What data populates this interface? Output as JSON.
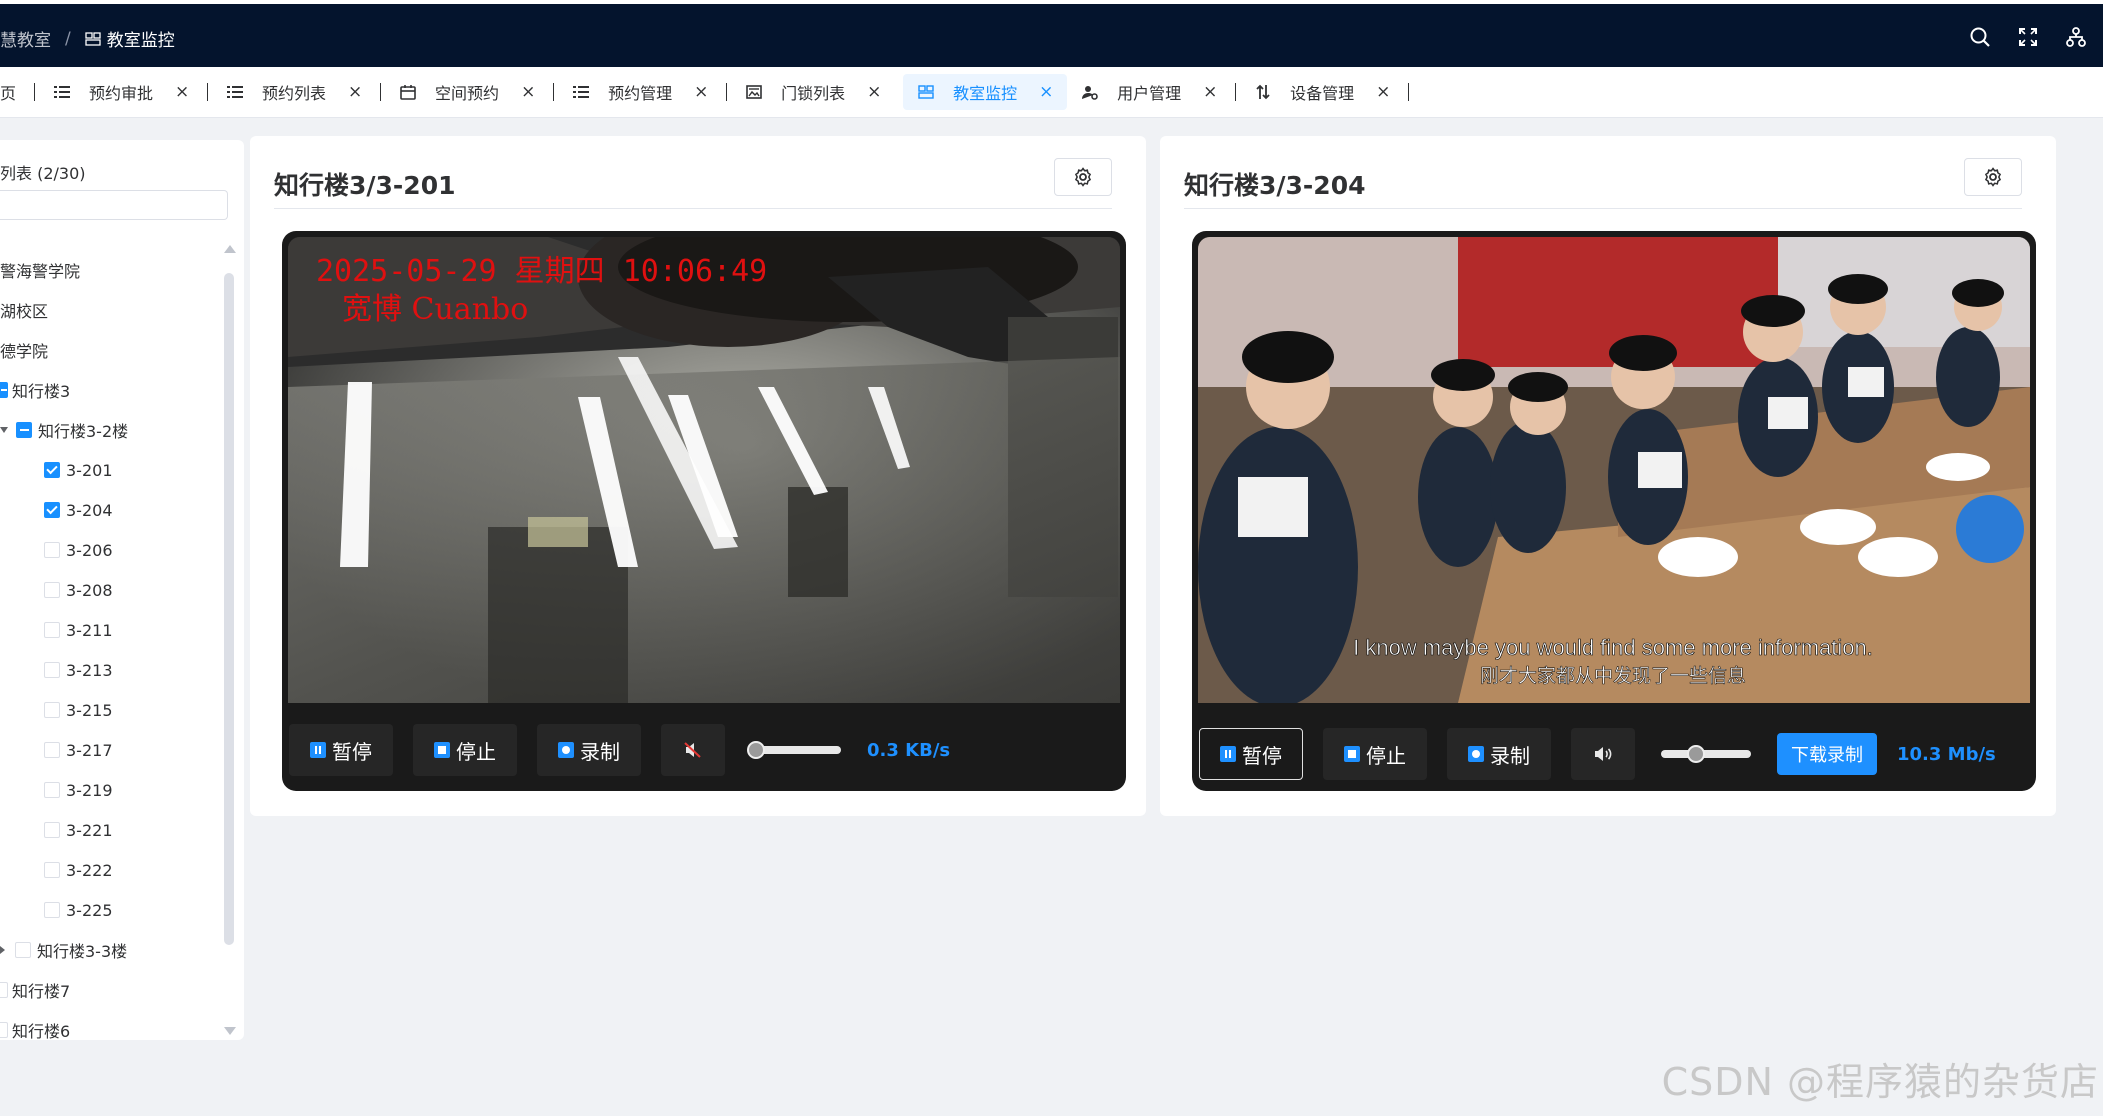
{
  "breadcrumb": {
    "parent": "慧教室",
    "separator": "/",
    "current": "教室监控"
  },
  "header_icons": [
    "search-icon",
    "fullscreen-icon",
    "sitemap-icon"
  ],
  "tabs": [
    {
      "label": "页",
      "icon": ""
    },
    {
      "label": "预约审批",
      "icon": "list-icon",
      "close": "×"
    },
    {
      "label": "预约列表",
      "icon": "list-icon",
      "close": "×"
    },
    {
      "label": "空间预约",
      "icon": "calendar-icon",
      "close": "×"
    },
    {
      "label": "预约管理",
      "icon": "list-icon",
      "close": "×"
    },
    {
      "label": "门锁列表",
      "icon": "image-icon",
      "close": "×"
    },
    {
      "label": "教室监控",
      "icon": "monitor-icon",
      "close": "×",
      "active": true
    },
    {
      "label": "用户管理",
      "icon": "user-gear-icon",
      "close": "×"
    },
    {
      "label": "设备管理",
      "icon": "sort-icon",
      "close": "×"
    }
  ],
  "sidebar": {
    "title": "列表 (2/30)",
    "search_placeholder": "",
    "tree": [
      {
        "label": "警海警学院",
        "level": 0,
        "state": "none"
      },
      {
        "label": "湖校区",
        "level": 0,
        "state": "none"
      },
      {
        "label": "德学院",
        "level": 0,
        "state": "none"
      },
      {
        "label": "知行楼3",
        "level": 1,
        "state": "indeterminate"
      },
      {
        "label": "知行楼3-2楼",
        "level": 2,
        "state": "indeterminate"
      },
      {
        "label": "3-201",
        "level": 3,
        "state": "checked"
      },
      {
        "label": "3-204",
        "level": 3,
        "state": "checked"
      },
      {
        "label": "3-206",
        "level": 3,
        "state": "unchecked"
      },
      {
        "label": "3-208",
        "level": 3,
        "state": "unchecked"
      },
      {
        "label": "3-211",
        "level": 3,
        "state": "unchecked"
      },
      {
        "label": "3-213",
        "level": 3,
        "state": "unchecked"
      },
      {
        "label": "3-215",
        "level": 3,
        "state": "unchecked"
      },
      {
        "label": "3-217",
        "level": 3,
        "state": "unchecked"
      },
      {
        "label": "3-219",
        "level": 3,
        "state": "unchecked"
      },
      {
        "label": "3-221",
        "level": 3,
        "state": "unchecked"
      },
      {
        "label": "3-222",
        "level": 3,
        "state": "unchecked"
      },
      {
        "label": "3-225",
        "level": 3,
        "state": "unchecked"
      },
      {
        "label": "知行楼3-3楼",
        "level": 2,
        "state": "unchecked"
      },
      {
        "label": "知行楼7",
        "level": 1,
        "state": "unchecked"
      },
      {
        "label": "知行楼6",
        "level": 1,
        "state": "unchecked"
      }
    ]
  },
  "cameras": [
    {
      "title": "知行楼3/3-201",
      "osd_datetime": "2025-05-29 星期四 10:06:49",
      "osd_brand": "宽博 Cuanbo",
      "controls": {
        "pause": "暂停",
        "stop": "停止",
        "record": "录制",
        "muted": true,
        "volume": 0.0,
        "speed": "0.3 KB/s"
      }
    },
    {
      "title": "知行楼3/3-204",
      "subtitle_en": "I know maybe you would find some more information.",
      "subtitle_zh": "刚才大家都从中发现了一些信息",
      "controls": {
        "pause": "暂停",
        "stop": "停止",
        "record": "录制",
        "muted": false,
        "volume": 0.35,
        "download": "下载录制",
        "speed": "10.3 Mb/s"
      }
    }
  ],
  "watermark": "CSDN @程序猿的杂货店",
  "colors": {
    "header_bg": "#04142d",
    "accent": "#1890ff",
    "player_bg": "#1a1a1a"
  }
}
